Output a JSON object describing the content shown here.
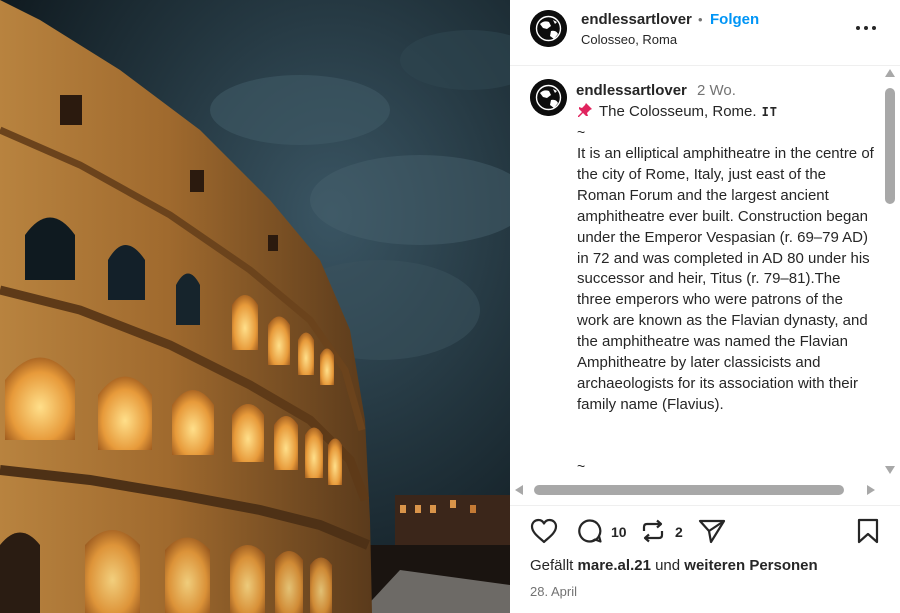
{
  "header": {
    "username": "endlessartlover",
    "separator": "•",
    "follow_label": "Folgen",
    "location": "Colosseo, Roma",
    "more_icon": "more-horizontal-icon"
  },
  "caption": {
    "username": "endlessartlover",
    "time": "2 Wo.",
    "pin_icon": "pushpin-icon",
    "title": "The Colosseum, Rome.",
    "flag": "IT",
    "tilde_top": "~",
    "body": "It is an elliptical amphitheatre in the centre of the city of Rome, Italy, just east of the Roman Forum and the largest ancient amphitheatre ever built. Construction began under the Emperor Vespasian (r. 69–79 AD) in 72 and was completed in AD 80 under his successor and heir, Titus (r. 79–81).The three emperors who were patrons of the work are known as the Flavian dynasty, and the amphitheatre was named the Flavian Amphitheatre by later classicists and archaeologists for its association with their family name (Flavius).",
    "tilde_bottom": "~"
  },
  "actions": {
    "like_icon": "heart-icon",
    "comment_icon": "comment-icon",
    "comment_count": "10",
    "repost_icon": "repost-icon",
    "repost_count": "2",
    "share_icon": "share-icon",
    "save_icon": "bookmark-icon"
  },
  "likes": {
    "prefix": "Gefällt",
    "user": "mare.al.21",
    "connector": "und",
    "others": "weiteren Personen"
  },
  "date": "28. April",
  "colors": {
    "accent": "#0095f6",
    "text": "#262626",
    "muted": "#737373",
    "pin": "#e0245e"
  }
}
